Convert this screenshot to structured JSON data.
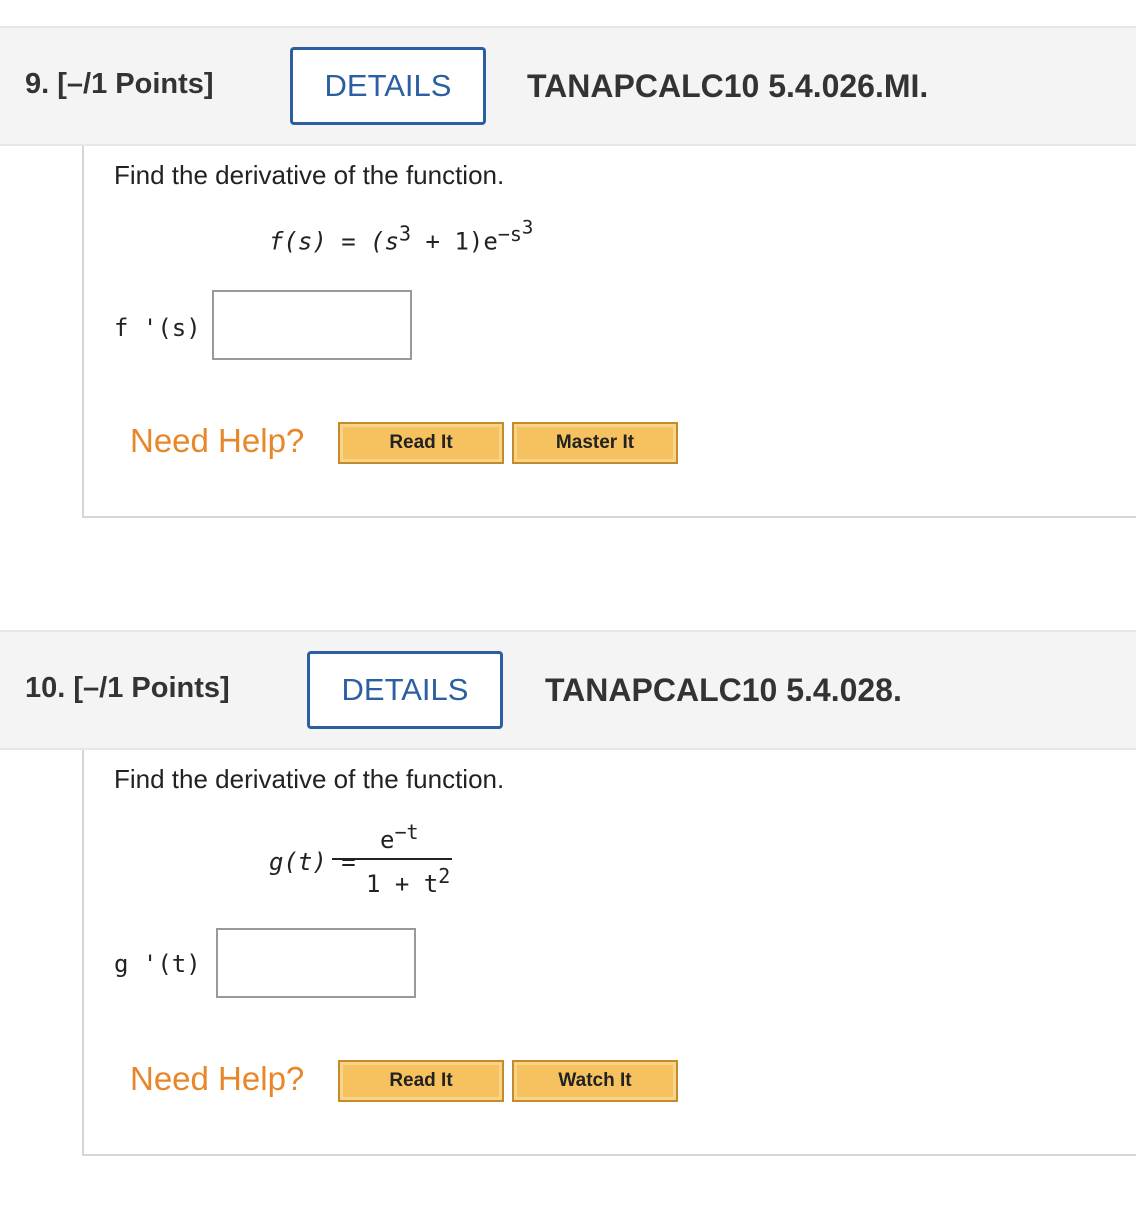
{
  "q9": {
    "number": "9.",
    "points": "[–/1 Points]",
    "details_label": "DETAILS",
    "code": "TANAPCALC10 5.4.026.MI.",
    "prompt": "Find the derivative of the function.",
    "function_lhs": "f(s) = (s",
    "exp1": "3",
    "function_mid": " + 1)e",
    "exp_neg": "−s",
    "exp_red": "3",
    "answer_label": "f '(s) =",
    "answer_value": "",
    "need_help": "Need Help?",
    "btn1": "Read It",
    "btn2": "Master It"
  },
  "q10": {
    "number": "10.",
    "points": "[–/1 Points]",
    "details_label": "DETAILS",
    "code": "TANAPCALC10 5.4.028.",
    "prompt": "Find the derivative of the function.",
    "function_lhs": "g(t) =",
    "numerator_base": "e",
    "numerator_exp": "−t",
    "denominator_base": "1 + t",
    "denominator_exp": "2",
    "answer_label": "g '(t) =",
    "answer_value": "",
    "need_help": "Need Help?",
    "btn1": "Read It",
    "btn2": "Watch It"
  },
  "colors": {
    "details_blue": "#2b5fa1",
    "help_orange": "#e8862a",
    "button_gold": "#f5c25f"
  }
}
